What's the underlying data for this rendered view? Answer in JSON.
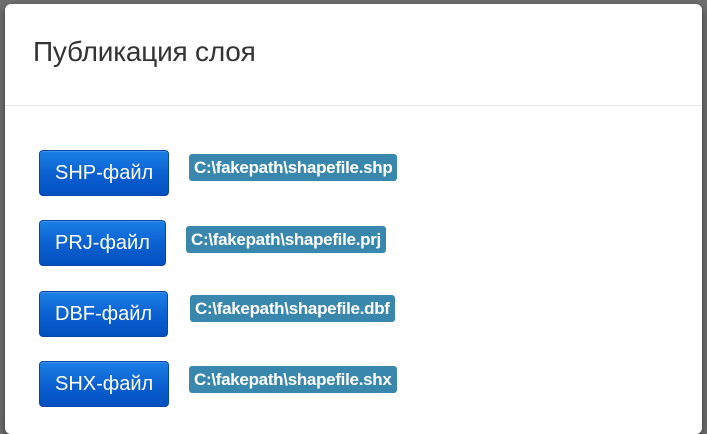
{
  "modal": {
    "title": "Публикация слоя",
    "files": [
      {
        "button_label": "SHP-файл",
        "path": "C:\\fakepath\\shapefile.shp"
      },
      {
        "button_label": "PRJ-файл",
        "path": "C:\\fakepath\\shapefile.prj"
      },
      {
        "button_label": "DBF-файл",
        "path": "C:\\fakepath\\shapefile.dbf"
      },
      {
        "button_label": "SHX-файл",
        "path": "C:\\fakepath\\shapefile.shx"
      }
    ]
  },
  "colors": {
    "button_blue": "#0a5fd0",
    "badge_blue": "#3a87ad",
    "title_text": "#333333"
  }
}
